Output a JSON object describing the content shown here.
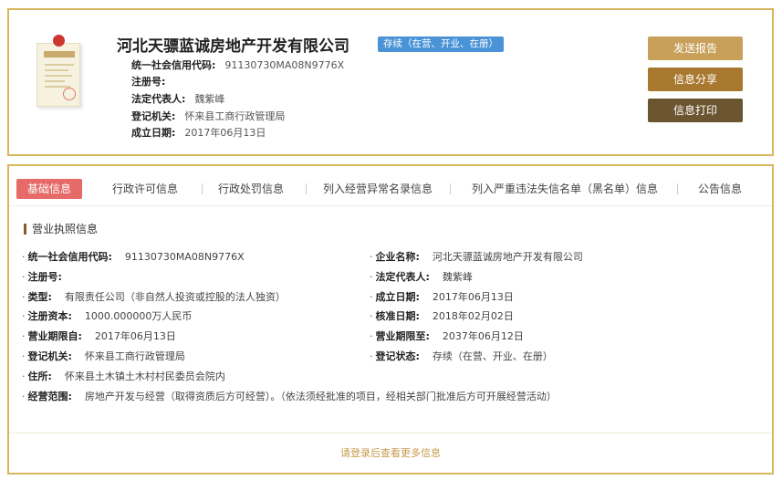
{
  "header": {
    "company_name": "河北天骠蓝诚房地产开发有限公司",
    "status_badge": "存续（在营、开业、在册）",
    "rows": [
      {
        "label": "统一社会信用代码:",
        "value": "91130730MA08N9776X"
      },
      {
        "label": "注册号:",
        "value": ""
      },
      {
        "label": "法定代表人:",
        "value": "魏紫峰"
      },
      {
        "label": "登记机关:",
        "value": "怀来县工商行政管理局"
      },
      {
        "label": "成立日期:",
        "value": "2017年06月13日"
      }
    ],
    "buttons": {
      "report": "发送报告",
      "share": "信息分享",
      "print": "信息打印"
    }
  },
  "tabs": [
    {
      "label": "基础信息",
      "active": true
    },
    {
      "label": "行政许可信息"
    },
    {
      "label": "行政处罚信息"
    },
    {
      "label": "列入经营异常名录信息"
    },
    {
      "label": "列入严重违法失信名单（黑名单）信息"
    },
    {
      "label": "公告信息"
    }
  ],
  "section_title": "营业执照信息",
  "fields": {
    "credit_code": {
      "label": "统一社会信用代码:",
      "value": "91130730MA08N9776X"
    },
    "company_name": {
      "label": "企业名称:",
      "value": "河北天骠蓝诚房地产开发有限公司"
    },
    "reg_no": {
      "label": "注册号:",
      "value": ""
    },
    "legal_rep": {
      "label": "法定代表人:",
      "value": "魏紫峰"
    },
    "type": {
      "label": "类型:",
      "value": "有限责任公司（非自然人投资或控股的法人独资）"
    },
    "established": {
      "label": "成立日期:",
      "value": "2017年06月13日"
    },
    "capital": {
      "label": "注册资本:",
      "value": "1000.000000万人民币"
    },
    "approved": {
      "label": "核准日期:",
      "value": "2018年02月02日"
    },
    "term_from": {
      "label": "营业期限自:",
      "value": "2017年06月13日"
    },
    "term_to": {
      "label": "营业期限至:",
      "value": "2037年06月12日"
    },
    "authority": {
      "label": "登记机关:",
      "value": "怀来县工商行政管理局"
    },
    "reg_status": {
      "label": "登记状态:",
      "value": "存续（在营、开业、在册）"
    },
    "address": {
      "label": "住所:",
      "value": "怀来县土木镇土木村村民委员会院内"
    },
    "scope": {
      "label": "经营范围:",
      "value": "房地产开发与经营（取得资质后方可经营）。（依法须经批准的项目，经相关部门批准后方可开展经营活动）"
    }
  },
  "bullet": "·",
  "login_prompt": "请登录后查看更多信息",
  "colors": {
    "border": "#d9b65c",
    "badge": "#4a93d6",
    "active_tab": "#e56a68",
    "btn_report": "#c9a05a",
    "btn_share": "#a8782f",
    "btn_print": "#6b5430",
    "login_text": "#c59a4a"
  }
}
